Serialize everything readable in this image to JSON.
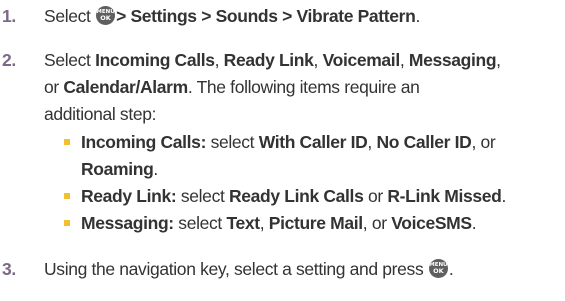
{
  "menu_icon": {
    "top": "MENU",
    "bottom": "OK"
  },
  "steps": [
    {
      "number": "1.",
      "lines": [
        {
          "select": "Select",
          "path": "> Settings > Sounds > Vibrate Pattern",
          "end": "."
        }
      ]
    },
    {
      "number": "2.",
      "lines": [
        {
          "a": "Select",
          "b1": "Incoming Calls",
          "s1": ",",
          "b2": "Ready Link",
          "s2": ",",
          "b3": "Voicemail",
          "s3": ",",
          "b4": "Messaging",
          "s4": ","
        },
        {
          "a": "or",
          "b1": "Calendar/Alarm",
          "s1": ". The following items require an"
        },
        {
          "a": "additional step:"
        }
      ],
      "bullets": [
        {
          "b1": "Incoming Calls:",
          "t1": "select",
          "b2": "With Caller ID",
          "t2": ",",
          "b3": "No Caller ID",
          "t3": ", or",
          "b4": "Roaming",
          "t4": "."
        },
        {
          "b1": "Ready Link:",
          "t1": "select",
          "b2": "Ready Link Calls",
          "t2": "or",
          "b3": "R-Link Missed",
          "t3": "."
        },
        {
          "b1": "Messaging:",
          "t1": "select",
          "b2": "Text",
          "t2": ",",
          "b3": "Picture Mail",
          "t3": ", or",
          "b4": "VoiceSMS",
          "t4": "."
        }
      ]
    },
    {
      "number": "3.",
      "lines": [
        {
          "text": "Using the navigation key, select a setting and press",
          "end": "."
        }
      ]
    }
  ]
}
